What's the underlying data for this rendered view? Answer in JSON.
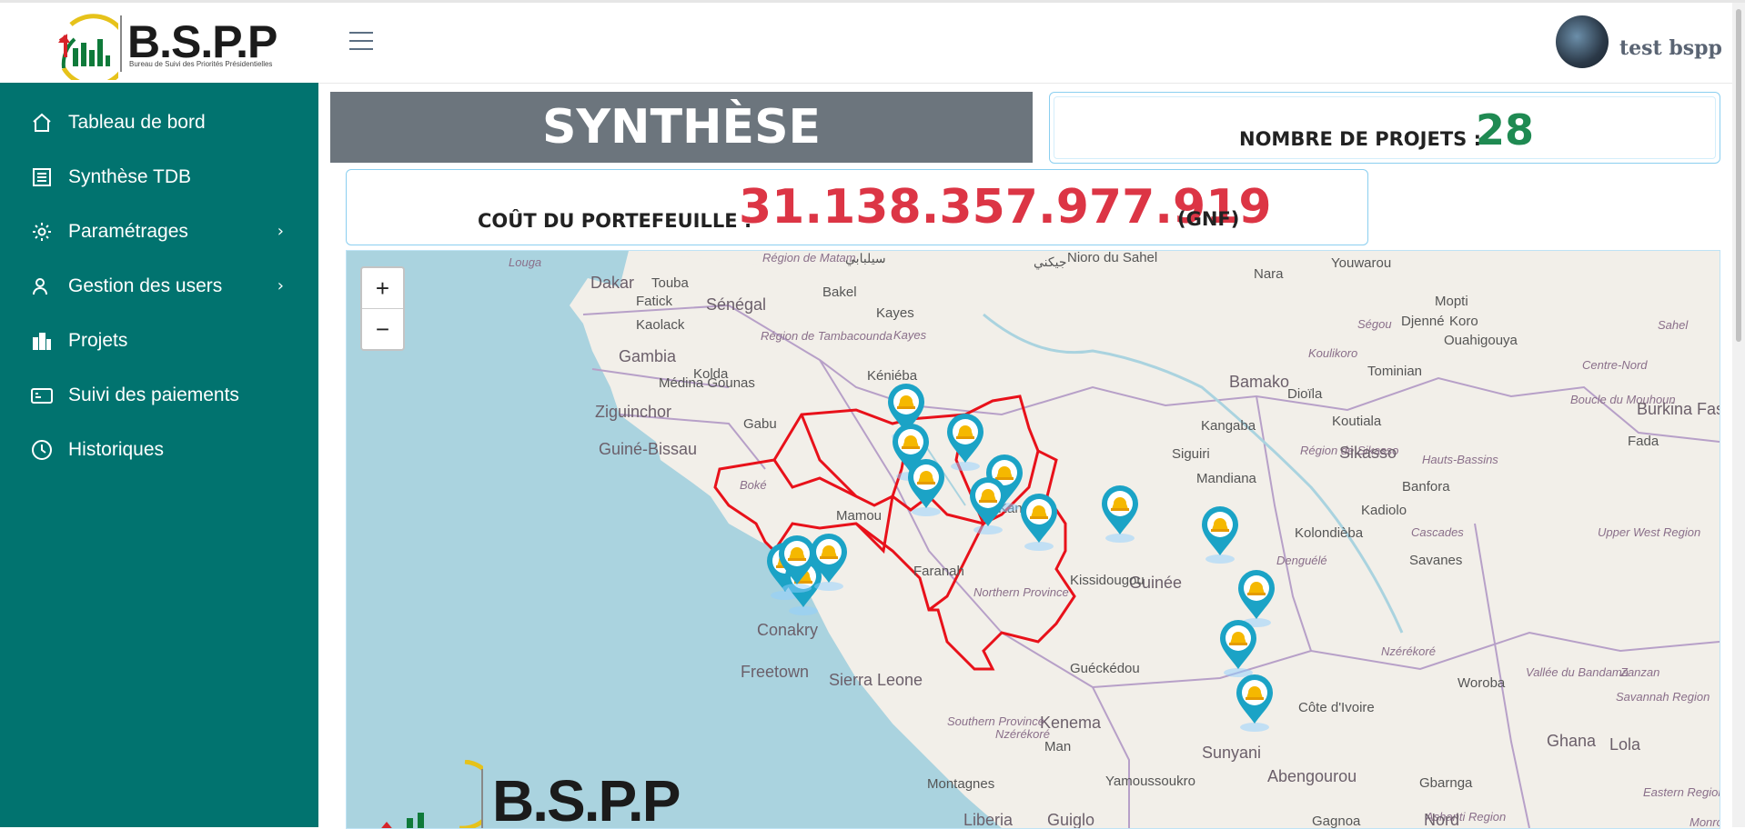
{
  "brand": {
    "name": "B.S.P.P",
    "subtitle": "Bureau de Suivi des Priorités Présidentielles",
    "colors": {
      "sidebar": "#01736f",
      "accent_red": "#dc3545",
      "accent_green": "#1f8a52",
      "synthese_bg": "#6c757d"
    }
  },
  "sidebar": {
    "items": [
      {
        "label": "Tableau de bord",
        "icon": "home-icon",
        "submenu": false
      },
      {
        "label": "Synthèse TDB",
        "icon": "document-list-icon",
        "submenu": false
      },
      {
        "label": "Paramétrages",
        "icon": "gear-icon",
        "submenu": true
      },
      {
        "label": "Gestion des users",
        "icon": "user-icon",
        "submenu": true
      },
      {
        "label": "Projets",
        "icon": "buildings-icon",
        "submenu": false
      },
      {
        "label": "Suivi des paiements",
        "icon": "payment-icon",
        "submenu": false
      },
      {
        "label": "Historiques",
        "icon": "history-clock-icon",
        "submenu": false
      }
    ]
  },
  "header": {
    "menu_icon": "hamburger-icon",
    "user_name": "test bspp"
  },
  "synthese": {
    "title": "SYNTHÈSE",
    "projects_label": "NOMBRE DE PROJETS :",
    "projects_count": "28",
    "cost_label": "COÛT DU PORTEFEUILLE :",
    "cost_value": "31.138.357.977.919",
    "cost_unit": "(GNF)"
  },
  "map": {
    "zoom_in": "+",
    "zoom_out": "−",
    "marker_icon": "project-location-marker-icon",
    "watermark": "B.S.P.P",
    "labels": [
      "Louga",
      "Dakar",
      "Touba",
      "Sénégal",
      "Fatick",
      "Kaolack",
      "Région de Matam",
      "Bakel",
      "Kayes",
      "Région de Tambacounda",
      "Nioro du Sahel",
      "Nara",
      "Youwarou",
      "Mopti",
      "Djenné",
      "Ségou",
      "Koro",
      "Ouahigouya",
      "Sahel",
      "Koulikoro",
      "Kayes",
      "Gambia",
      "Kolda",
      "Médina Gounas",
      "Kéniéba",
      "Bamako",
      "Dioïla",
      "Tominian",
      "Centre-Nord",
      "Boucle du Mouhoun",
      "Burkina Faso",
      "Ziguinchor",
      "Gabu",
      "Kangaba",
      "Koutiala",
      "Fada",
      "Guiné-Bissau",
      "Siguiri",
      "Région de Sikasso",
      "Sikasso",
      "Hauts-Bassins",
      "Boké",
      "Mamou",
      "Kankan",
      "Mandiana",
      "Kolondièba",
      "Banfora",
      "Kadiolo",
      "Cascades",
      "Upper West Region",
      "Faranah",
      "Guinée",
      "Savanes",
      "Kissidougou",
      "Conakry",
      "Northern Province",
      "Denguélé",
      "Freetown",
      "Sierra Leone",
      "Guéckédou",
      "Nzérékoré",
      "Woroba",
      "Vallée du Bandama",
      "Zanzan",
      "Savannah Region",
      "Kenema",
      "Southern Province",
      "Nzérékoré",
      "Man",
      "Côte d'Ivoire",
      "Sunyani",
      "Ghana",
      "Lola",
      "Yamoussoukro",
      "Abengourou",
      "Gbarnga",
      "Montagnes",
      "Ashanti Region",
      "Eastern Region",
      "Monrovia",
      "Liberia",
      "Guiglo",
      "Gagnoa",
      "Nord"
    ],
    "arabic_labels": [
      "سيلبابي",
      "جيكني"
    ]
  },
  "scrollbar": {
    "icon": "vertical-scrollbar"
  }
}
